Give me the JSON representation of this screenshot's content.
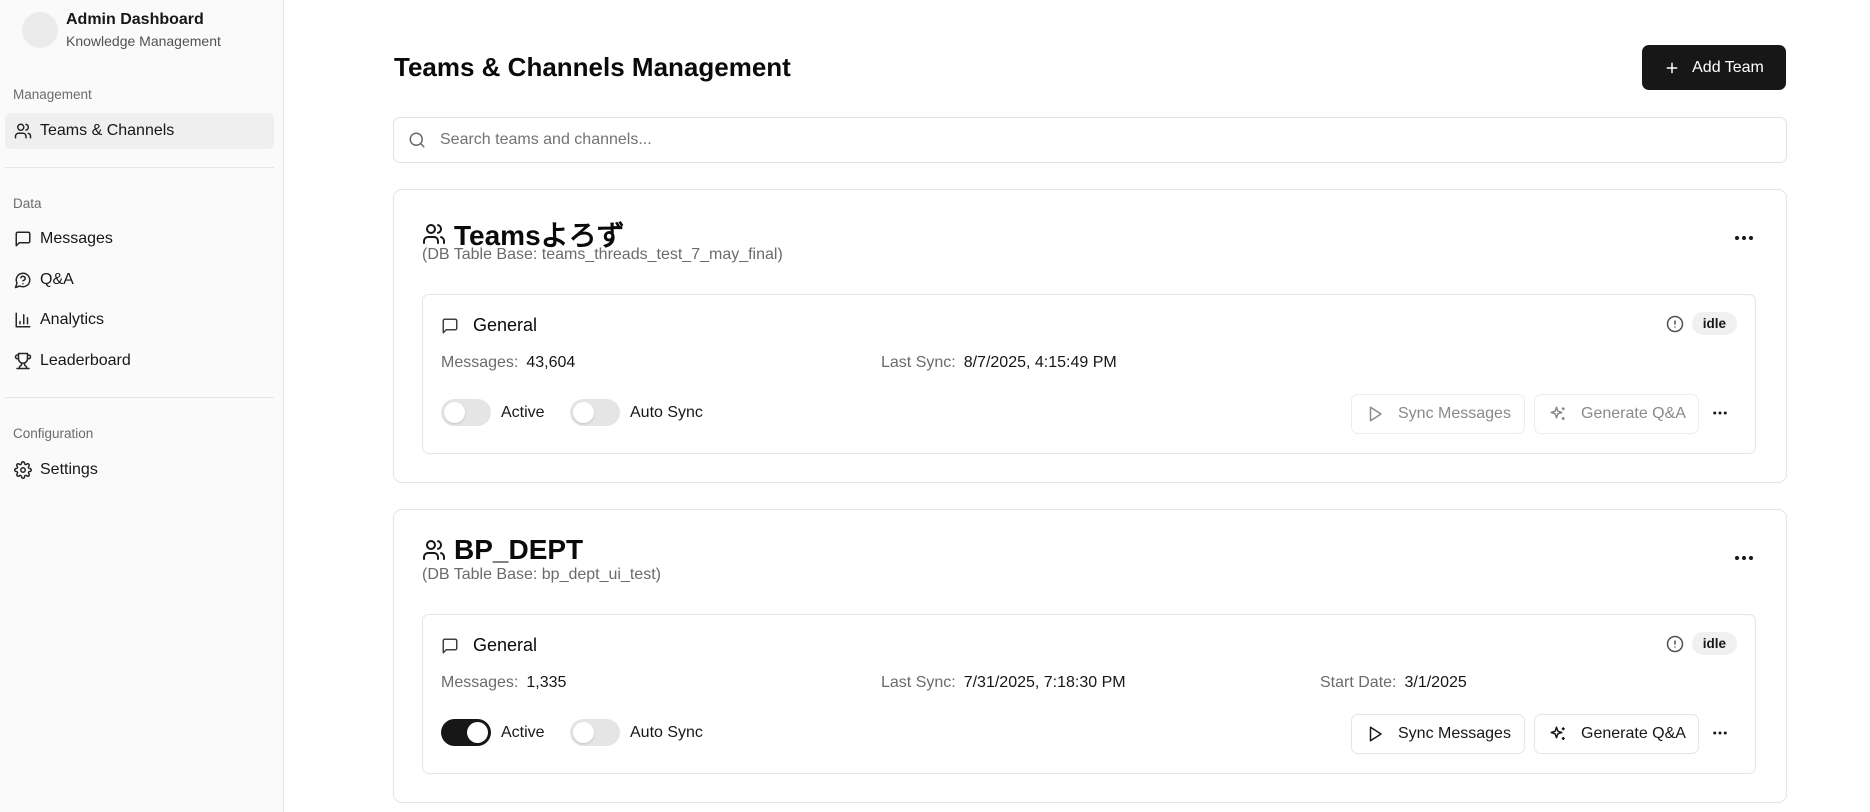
{
  "sidebar": {
    "brand_title": "Admin Dashboard",
    "brand_subtitle": "Knowledge Management",
    "groups": [
      {
        "label": "Management",
        "items": [
          {
            "label": "Teams & Channels",
            "icon": "users-icon",
            "active": true
          }
        ]
      },
      {
        "label": "Data",
        "items": [
          {
            "label": "Messages",
            "icon": "message-square-icon"
          },
          {
            "label": "Q&A",
            "icon": "help-circle-icon"
          },
          {
            "label": "Analytics",
            "icon": "bar-chart-icon"
          },
          {
            "label": "Leaderboard",
            "icon": "trophy-icon"
          }
        ]
      },
      {
        "label": "Configuration",
        "items": [
          {
            "label": "Settings",
            "icon": "gear-icon"
          }
        ]
      }
    ]
  },
  "header": {
    "title": "Teams & Channels Management",
    "add_team_label": "Add Team"
  },
  "search": {
    "placeholder": "Search teams and channels...",
    "value": ""
  },
  "teams": [
    {
      "name": "Teamsよろず",
      "db_table_base": "(DB Table Base: teams_threads_test_7_may_final)",
      "channels": [
        {
          "name": "General",
          "status": "idle",
          "messages_label": "Messages:",
          "messages": "43,604",
          "last_sync_label": "Last Sync:",
          "last_sync": "8/7/2025, 4:15:49 PM",
          "active_label": "Active",
          "active": false,
          "auto_sync_label": "Auto Sync",
          "auto_sync": false,
          "sync_label": "Sync Messages",
          "generate_label": "Generate Q&A",
          "actions_enabled": false
        }
      ]
    },
    {
      "name": "BP_DEPT",
      "db_table_base": "(DB Table Base: bp_dept_ui_test)",
      "channels": [
        {
          "name": "General",
          "status": "idle",
          "messages_label": "Messages:",
          "messages": "1,335",
          "last_sync_label": "Last Sync:",
          "last_sync": "7/31/2025, 7:18:30 PM",
          "start_date_label": "Start Date:",
          "start_date": "3/1/2025",
          "active_label": "Active",
          "active": true,
          "auto_sync_label": "Auto Sync",
          "auto_sync": false,
          "sync_label": "Sync Messages",
          "generate_label": "Generate Q&A",
          "actions_enabled": true
        }
      ]
    }
  ],
  "colors": {
    "primary": "#171717",
    "sidebar_bg": "#fafafa",
    "border": "#e5e5e5",
    "muted_text": "#6b6b6b"
  }
}
